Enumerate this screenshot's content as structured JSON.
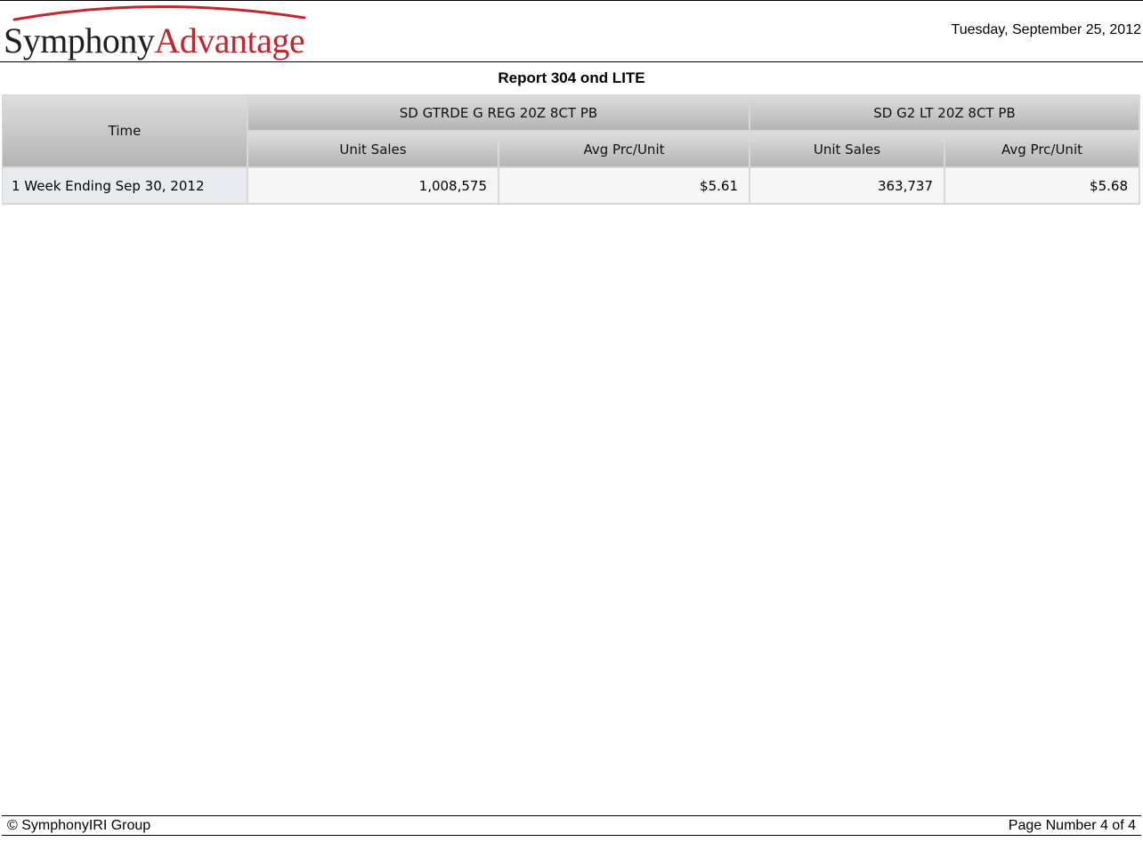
{
  "header": {
    "logo_part1": "Symphony",
    "logo_part2": "Advantage",
    "date": "Tuesday, September 25, 2012"
  },
  "report": {
    "title": "Report 304 ond LITE"
  },
  "table": {
    "row_header": "Time",
    "groups": [
      {
        "label": "SD GTRDE G REG 20Z 8CT PB",
        "columns": [
          "Unit Sales",
          "Avg Prc/Unit"
        ]
      },
      {
        "label": "SD G2 LT 20Z 8CT PB",
        "columns": [
          "Unit Sales",
          "Avg Prc/Unit"
        ]
      }
    ],
    "rows": [
      {
        "time": "1 Week Ending Sep 30, 2012",
        "values": [
          "1,008,575",
          "$5.61",
          "363,737",
          "$5.68"
        ]
      }
    ]
  },
  "footer": {
    "copyright": "© SymphonyIRI Group",
    "page": "Page Number 4 of 4"
  },
  "colors": {
    "brand_red": "#c4262e",
    "header_gradient_top": "#dedede",
    "header_gradient_bottom": "#b4b4b4",
    "row_label_bg": "#e8ecf1"
  }
}
